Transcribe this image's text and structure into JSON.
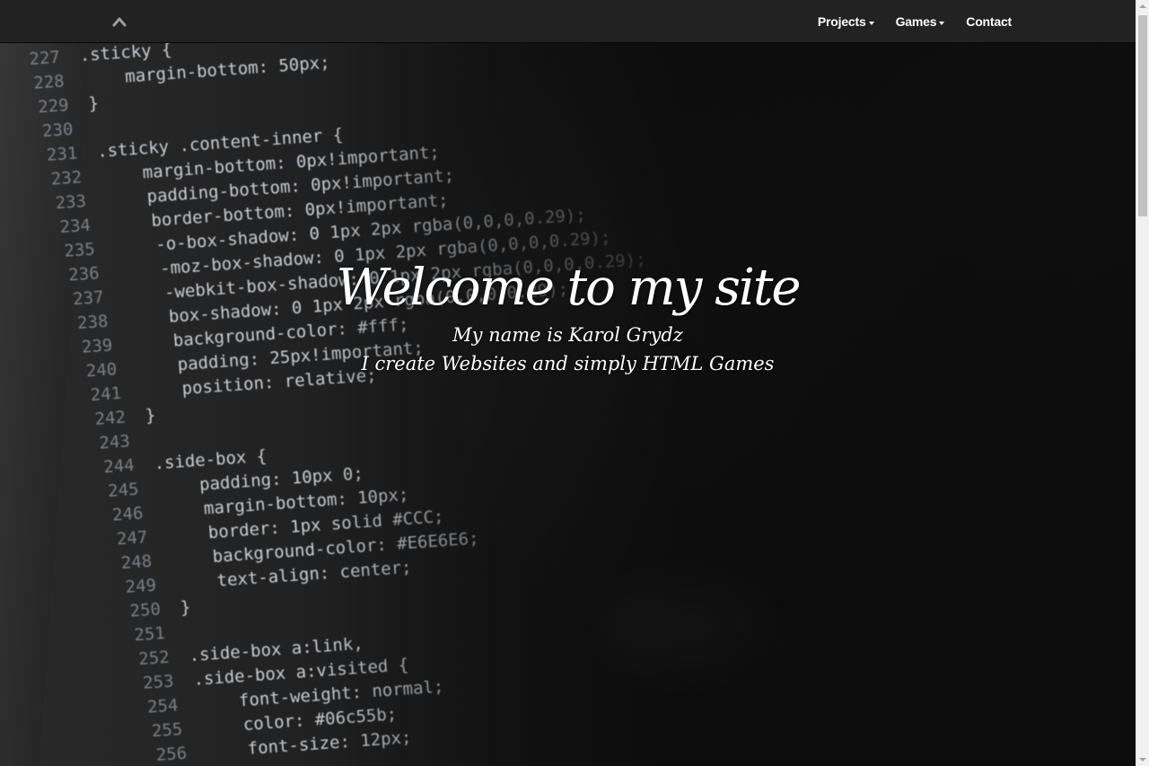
{
  "navbar": {
    "brand_icon": "chevron-up-icon",
    "items": [
      {
        "label": "Projects",
        "dropdown": true
      },
      {
        "label": "Games",
        "dropdown": true
      },
      {
        "label": "Contact",
        "dropdown": false
      }
    ]
  },
  "hero": {
    "title": "Welcome to my site",
    "subtitle_line1": "My name is Karol Grydz",
    "subtitle_line2": "I create Websites and simply HTML Games"
  },
  "code_lines": [
    {
      "n": "227",
      "code": ".sticky {"
    },
    {
      "n": "228",
      "code": "    margin-bottom: 50px;"
    },
    {
      "n": "229",
      "code": "}"
    },
    {
      "n": "230",
      "code": ""
    },
    {
      "n": "231",
      "code": ".sticky .content-inner {"
    },
    {
      "n": "232",
      "code": "    margin-bottom: 0px!important;"
    },
    {
      "n": "233",
      "code": "    padding-bottom: 0px!important;"
    },
    {
      "n": "234",
      "code": "    border-bottom: 0px!important;"
    },
    {
      "n": "235",
      "code": "    -o-box-shadow: 0 1px 2px rgba(0,0,0,0.29);"
    },
    {
      "n": "236",
      "code": "    -moz-box-shadow: 0 1px 2px rgba(0,0,0,0.29);"
    },
    {
      "n": "237",
      "code": "    -webkit-box-shadow: 0 1px 2px rgba(0,0,0,0.29);"
    },
    {
      "n": "238",
      "code": "    box-shadow: 0 1px 2px rgba(0,0,0,0.29);"
    },
    {
      "n": "239",
      "code": "    background-color: #fff;"
    },
    {
      "n": "240",
      "code": "    padding: 25px!important;"
    },
    {
      "n": "241",
      "code": "    position: relative;"
    },
    {
      "n": "242",
      "code": "}"
    },
    {
      "n": "243",
      "code": ""
    },
    {
      "n": "244",
      "code": ".side-box {"
    },
    {
      "n": "245",
      "code": "    padding: 10px 0;"
    },
    {
      "n": "246",
      "code": "    margin-bottom: 10px;"
    },
    {
      "n": "247",
      "code": "    border: 1px solid #CCC;"
    },
    {
      "n": "248",
      "code": "    background-color: #E6E6E6;"
    },
    {
      "n": "249",
      "code": "    text-align: center;"
    },
    {
      "n": "250",
      "code": "}"
    },
    {
      "n": "251",
      "code": ""
    },
    {
      "n": "252",
      "code": ".side-box a:link,"
    },
    {
      "n": "253",
      "code": ".side-box a:visited {"
    },
    {
      "n": "254",
      "code": "    font-weight: normal;"
    },
    {
      "n": "255",
      "code": "    color: #06c55b;"
    },
    {
      "n": "256",
      "code": "    font-size: 12px;"
    }
  ],
  "colors": {
    "navbar_bg": "#222222",
    "text": "#ffffff"
  }
}
